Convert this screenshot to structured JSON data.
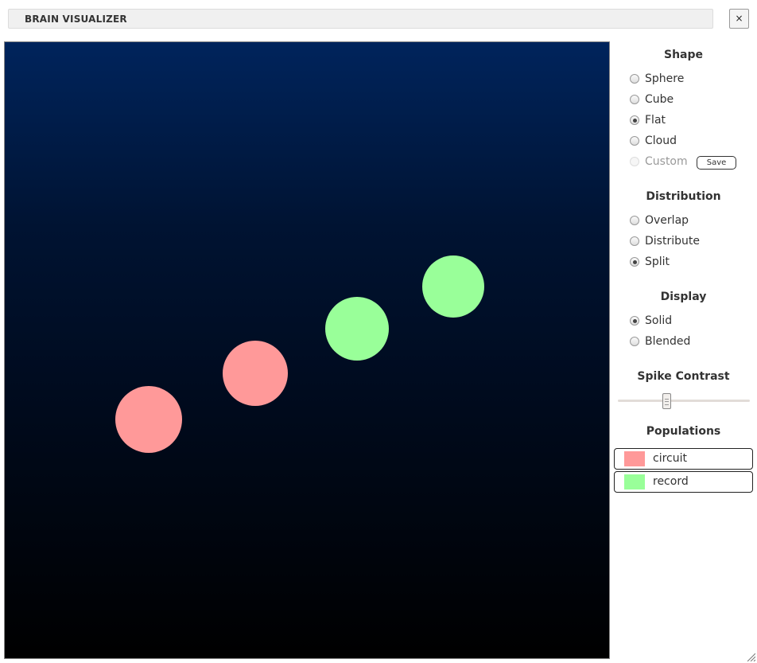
{
  "window": {
    "title": "BRAIN VISUALIZER",
    "close_label": "×"
  },
  "canvas": {
    "neurons": [
      {
        "population": "circuit",
        "color": "#ff9999"
      },
      {
        "population": "circuit",
        "color": "#ff9999"
      },
      {
        "population": "record",
        "color": "#99ff99"
      },
      {
        "population": "record",
        "color": "#99ff99"
      }
    ]
  },
  "shape": {
    "title": "Shape",
    "options": [
      {
        "label": "Sphere",
        "checked": false,
        "disabled": false
      },
      {
        "label": "Cube",
        "checked": false,
        "disabled": false
      },
      {
        "label": "Flat",
        "checked": true,
        "disabled": false
      },
      {
        "label": "Cloud",
        "checked": false,
        "disabled": false
      },
      {
        "label": "Custom",
        "checked": false,
        "disabled": true
      }
    ],
    "save_label": "Save"
  },
  "distribution": {
    "title": "Distribution",
    "options": [
      {
        "label": "Overlap",
        "checked": false
      },
      {
        "label": "Distribute",
        "checked": false
      },
      {
        "label": "Split",
        "checked": true
      }
    ]
  },
  "display": {
    "title": "Display",
    "options": [
      {
        "label": "Solid",
        "checked": true
      },
      {
        "label": "Blended",
        "checked": false
      }
    ]
  },
  "spike_contrast": {
    "title": "Spike Contrast",
    "value_fraction": 0.37
  },
  "populations": {
    "title": "Populations",
    "items": [
      {
        "label": "circuit",
        "color": "#ff9999"
      },
      {
        "label": "record",
        "color": "#99ff99"
      }
    ]
  }
}
